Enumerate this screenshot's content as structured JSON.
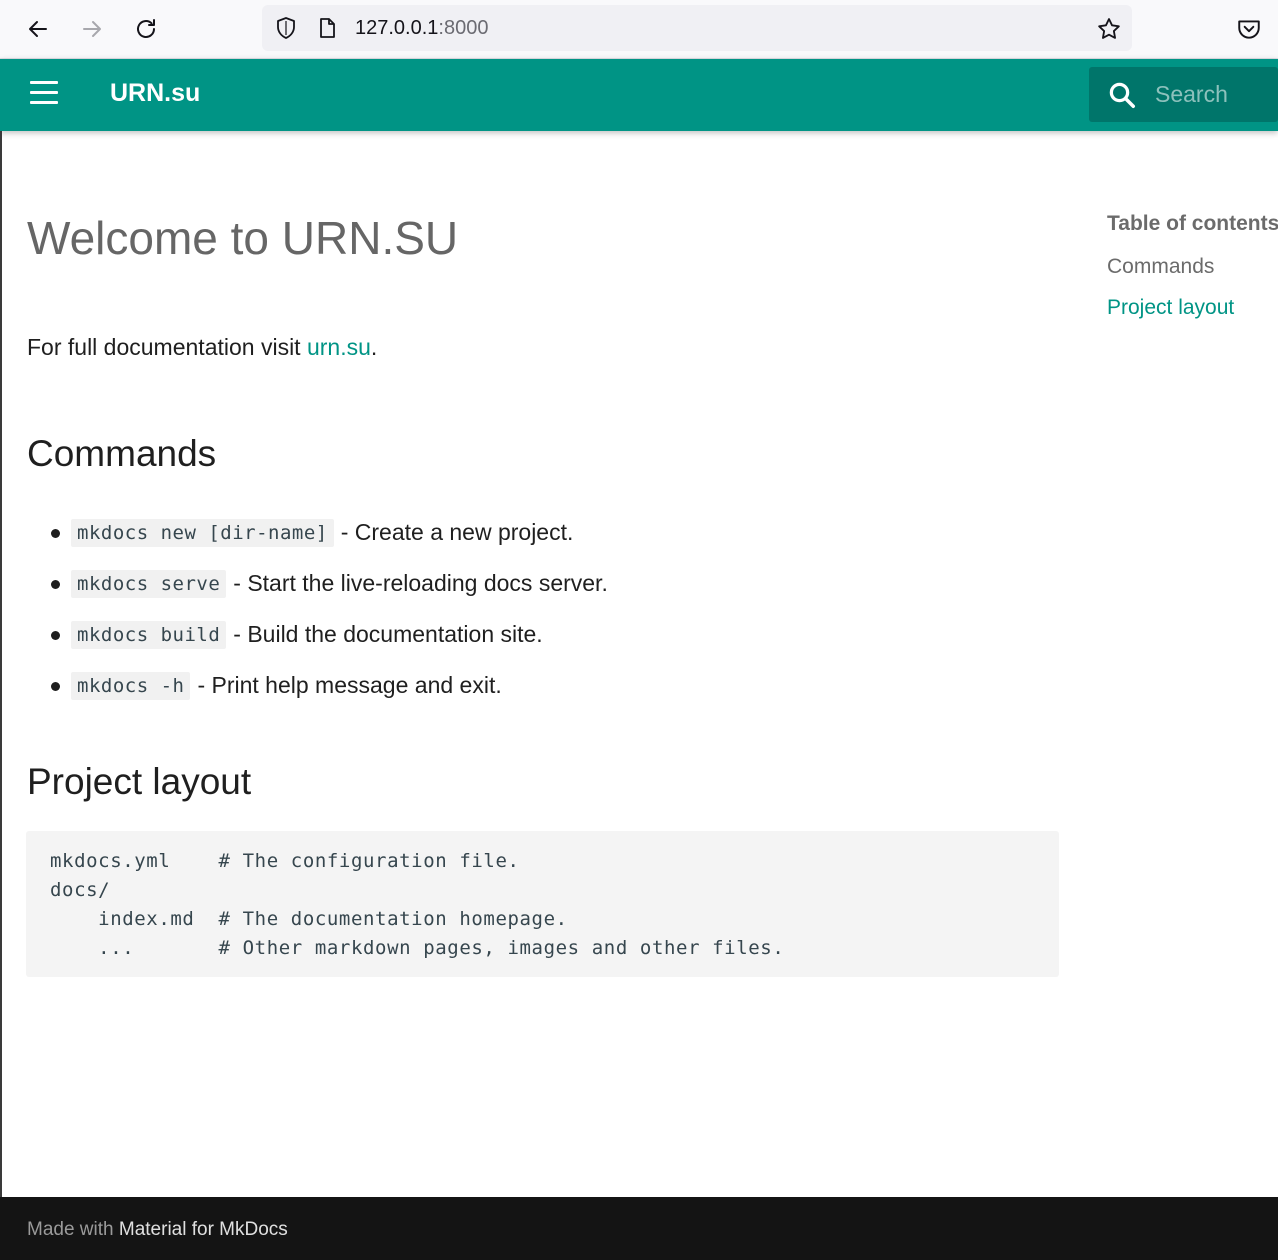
{
  "browser": {
    "url_host": "127.0.0.1",
    "url_port": ":8000"
  },
  "header": {
    "site_title": "URN.su",
    "search_placeholder": "Search"
  },
  "main": {
    "page_title": "Welcome to URN.SU",
    "intro_text": "For full documentation visit ",
    "intro_link": "urn.su",
    "intro_end": ".",
    "commands_heading": "Commands",
    "commands": [
      {
        "code": "mkdocs new [dir-name]",
        "desc": "- Create a new project."
      },
      {
        "code": "mkdocs serve",
        "desc": "- Start the live-reloading docs server."
      },
      {
        "code": "mkdocs build",
        "desc": "- Build the documentation site."
      },
      {
        "code": "mkdocs -h",
        "desc": "- Print help message and exit."
      }
    ],
    "layout_heading": "Project layout",
    "layout_code": "mkdocs.yml    # The configuration file.\ndocs/\n    index.md  # The documentation homepage.\n    ...       # Other markdown pages, images and other files."
  },
  "toc": {
    "title": "Table of contents",
    "items": [
      "Commands",
      "Project layout"
    ]
  },
  "footer": {
    "made_with": "Made with ",
    "link": "Material for MkDocs"
  },
  "colors": {
    "primary": "#009485",
    "search_bg": "#00756a",
    "footer_bg": "#141414"
  },
  "icons": [
    "back-arrow-icon",
    "forward-arrow-icon",
    "reload-icon",
    "shield-icon",
    "page-icon",
    "star-icon",
    "pocket-icon",
    "hamburger-menu-icon",
    "search-icon"
  ]
}
